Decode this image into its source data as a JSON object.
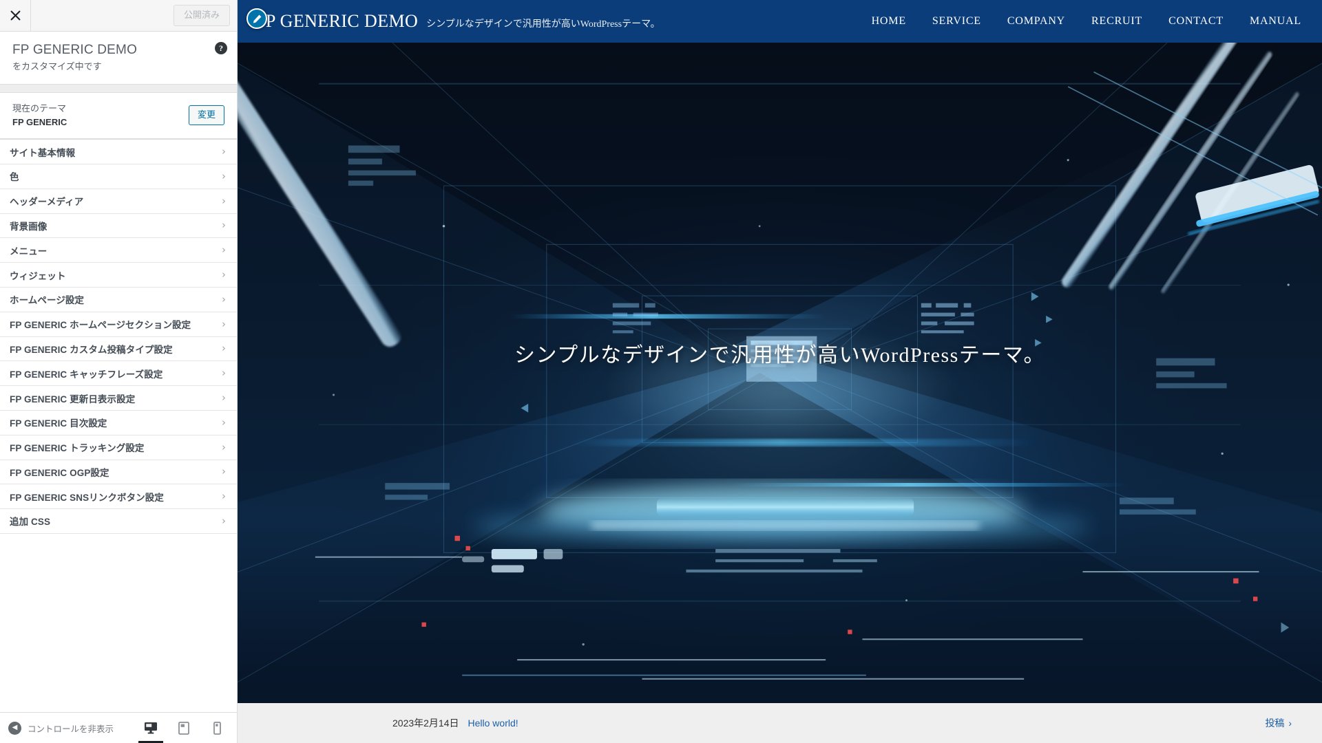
{
  "customizer": {
    "close_label": "×",
    "publish_label": "公開済み",
    "panel_title": "FP GENERIC DEMO",
    "panel_subtitle": "をカスタマイズ中です",
    "help_label": "?",
    "theme": {
      "label": "現在のテーマ",
      "name": "FP GENERIC",
      "change_label": "変更"
    },
    "sections": [
      {
        "label": "サイト基本情報",
        "chevron": "›"
      },
      {
        "label": "色",
        "chevron": "›"
      },
      {
        "label": "ヘッダーメディア",
        "chevron": "›"
      },
      {
        "label": "背景画像",
        "chevron": "›"
      },
      {
        "label": "メニュー",
        "chevron": "›"
      },
      {
        "label": "ウィジェット",
        "chevron": "›"
      },
      {
        "label": "ホームページ設定",
        "chevron": "›"
      },
      {
        "label": "FP GENERIC ホームページセクション設定",
        "chevron": "›"
      },
      {
        "label": "FP GENERIC カスタム投稿タイプ設定",
        "chevron": "›"
      },
      {
        "label": "FP GENERIC キャッチフレーズ設定",
        "chevron": "›"
      },
      {
        "label": "FP GENERIC 更新日表示設定",
        "chevron": "›"
      },
      {
        "label": "FP GENERIC 目次設定",
        "chevron": "›"
      },
      {
        "label": "FP GENERIC トラッキング設定",
        "chevron": "›"
      },
      {
        "label": "FP GENERIC OGP設定",
        "chevron": "›"
      },
      {
        "label": "FP GENERIC SNSリンクボタン設定",
        "chevron": "›"
      },
      {
        "label": "追加 CSS",
        "chevron": "›"
      }
    ],
    "footer": {
      "collapse_label": "コントロールを非表示",
      "collapse_arrow": "◀",
      "devices": [
        {
          "name": "desktop",
          "active": true
        },
        {
          "name": "tablet",
          "active": false
        },
        {
          "name": "mobile",
          "active": false
        }
      ]
    }
  },
  "preview": {
    "site_title": "FP GENERIC DEMO",
    "site_description": "シンプルなデザインで汎用性が高いWordPressテーマ。",
    "nav": [
      {
        "label": "HOME"
      },
      {
        "label": "SERVICE"
      },
      {
        "label": "COMPANY"
      },
      {
        "label": "RECRUIT"
      },
      {
        "label": "CONTACT"
      },
      {
        "label": "MANUAL"
      }
    ],
    "hero_text": "シンプルなデザインで汎用性が高いWordPressテーマ。",
    "footer": {
      "post_date": "2023年2月14日",
      "post_title": "Hello world!",
      "more_label": "投稿",
      "more_chevron": "›"
    }
  },
  "colors": {
    "header_blue": "#0b3d7a",
    "link_blue": "#1c5fa8",
    "accent_blue": "#0073aa",
    "sidebar_bg": "#ffffff",
    "footer_bg": "#efefef"
  }
}
